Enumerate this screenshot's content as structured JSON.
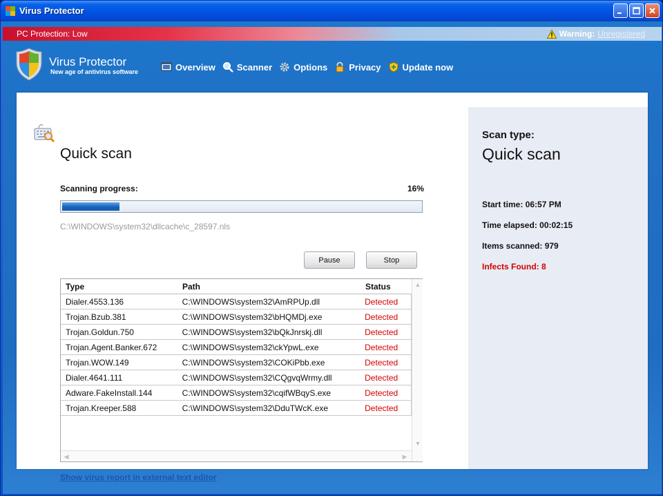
{
  "window": {
    "title": "Virus Protector"
  },
  "status_bar": {
    "protection": "PC Protection: Low",
    "warning_label": "Warning:",
    "warning_link": "Unregistered"
  },
  "brand": {
    "name": "Virus Protector",
    "tagline": "New age of antivirus software"
  },
  "nav": [
    {
      "label": "Overview",
      "icon": "monitor-icon"
    },
    {
      "label": "Scanner",
      "icon": "magnifier-icon"
    },
    {
      "label": "Options",
      "icon": "gear-icon"
    },
    {
      "label": "Privacy",
      "icon": "lock-icon"
    },
    {
      "label": "Update now",
      "icon": "shield-update-icon"
    }
  ],
  "scan": {
    "heading": "Quick scan",
    "progress_label": "Scanning progress:",
    "progress_text": "16%",
    "progress_value": 0.16,
    "current_file": "C:\\WINDOWS\\system32\\dllcache\\c_28597.nls",
    "pause_label": "Pause",
    "stop_label": "Stop"
  },
  "results": {
    "columns": [
      "Type",
      "Path",
      "Status"
    ],
    "rows": [
      {
        "type": "Dialer.4553.136",
        "path": "C:\\WINDOWS\\system32\\AmRPUp.dll",
        "status": "Detected"
      },
      {
        "type": "Trojan.Bzub.381",
        "path": "C:\\WINDOWS\\system32\\bHQMDj.exe",
        "status": "Detected"
      },
      {
        "type": "Trojan.Goldun.750",
        "path": "C:\\WINDOWS\\system32\\bQkJnrskj.dll",
        "status": "Detected"
      },
      {
        "type": "Trojan.Agent.Banker.672",
        "path": "C:\\WINDOWS\\system32\\ckYpwL.exe",
        "status": "Detected"
      },
      {
        "type": "Trojan.WOW.149",
        "path": "C:\\WINDOWS\\system32\\COKiPbb.exe",
        "status": "Detected"
      },
      {
        "type": "Dialer.4641.111",
        "path": "C:\\WINDOWS\\system32\\CQgvqWrmy.dll",
        "status": "Detected"
      },
      {
        "type": "Adware.FakeInstall.144",
        "path": "C:\\WINDOWS\\system32\\cqifWBqyS.exe",
        "status": "Detected"
      },
      {
        "type": "Trojan.Kreeper.588",
        "path": "C:\\WINDOWS\\system32\\DduTWcK.exe",
        "status": "Detected"
      }
    ]
  },
  "report_link": "Show virus report in external text editor",
  "summary": {
    "scan_type_label": "Scan type:",
    "scan_type_value": "Quick scan",
    "start_time": "Start time: 06:57 PM",
    "time_elapsed": "Time elapsed: 00:02:15",
    "items_scanned": "Items scanned: 979",
    "infects_found": "Infects Found: 8"
  },
  "colors": {
    "accent_blue": "#1f6dc1",
    "danger_red": "#d40000",
    "link_blue": "#1a56b0"
  }
}
